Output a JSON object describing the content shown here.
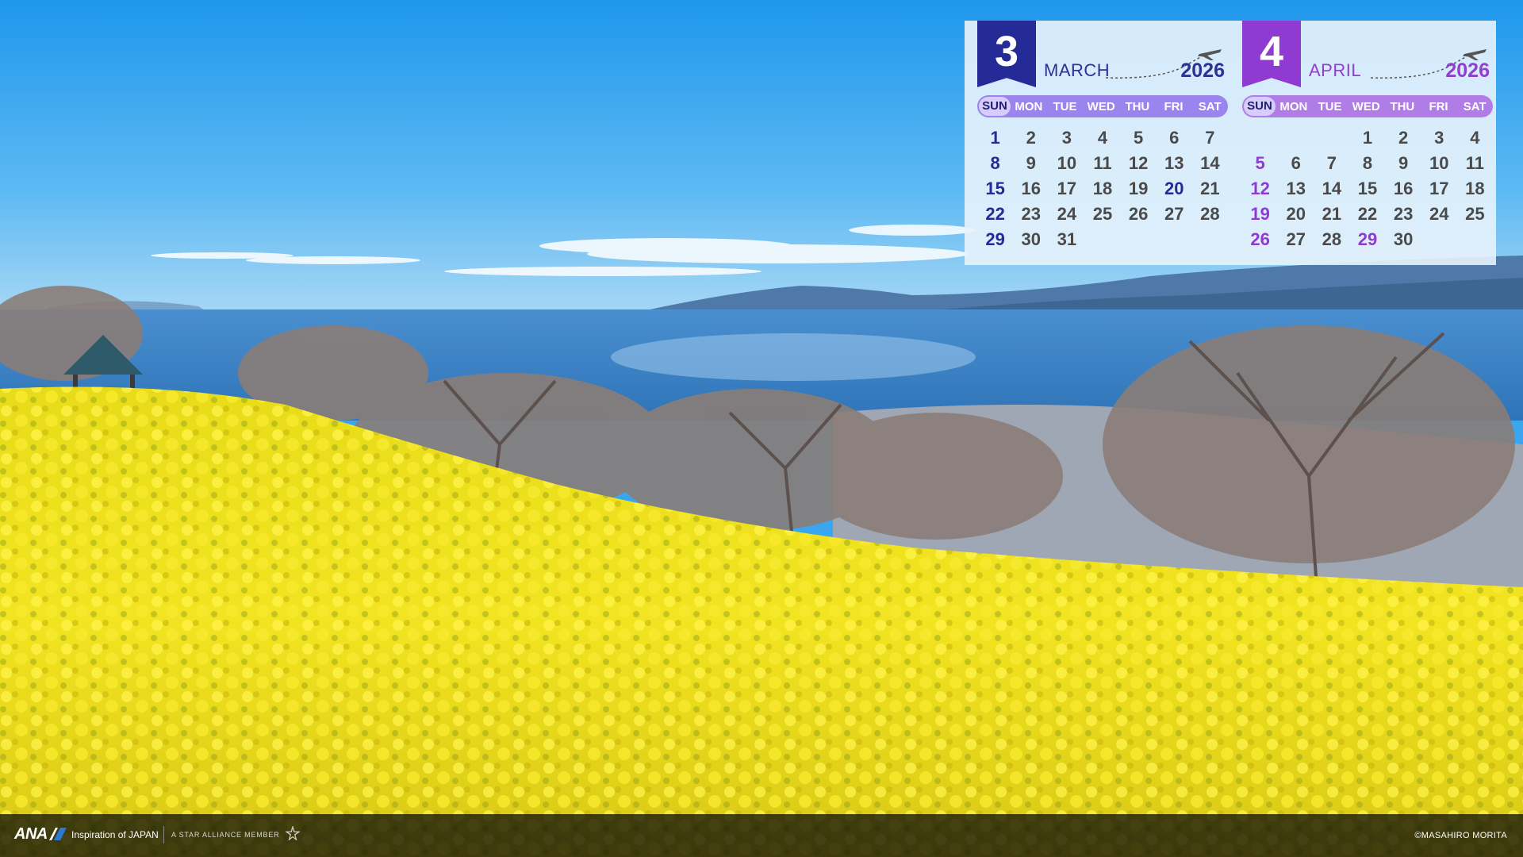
{
  "calendar": {
    "months": [
      {
        "number": "3",
        "name": "MARCH",
        "year": "2026",
        "weekdays": [
          "SUN",
          "MON",
          "TUE",
          "WED",
          "THU",
          "FRI",
          "SAT"
        ],
        "lead_blanks": 0,
        "days": [
          "1",
          "2",
          "3",
          "4",
          "5",
          "6",
          "7",
          "8",
          "9",
          "10",
          "11",
          "12",
          "13",
          "14",
          "15",
          "16",
          "17",
          "18",
          "19",
          "20",
          "21",
          "22",
          "23",
          "24",
          "25",
          "26",
          "27",
          "28",
          "29",
          "30",
          "31"
        ],
        "highlight_days": [
          "20"
        ]
      },
      {
        "number": "4",
        "name": "APRIL",
        "year": "2026",
        "weekdays": [
          "SUN",
          "MON",
          "TUE",
          "WED",
          "THU",
          "FRI",
          "SAT"
        ],
        "lead_blanks": 3,
        "days": [
          "1",
          "2",
          "3",
          "4",
          "5",
          "6",
          "7",
          "8",
          "9",
          "10",
          "11",
          "12",
          "13",
          "14",
          "15",
          "16",
          "17",
          "18",
          "19",
          "20",
          "21",
          "22",
          "23",
          "24",
          "25",
          "26",
          "27",
          "28",
          "29",
          "30"
        ],
        "highlight_days": [
          "29"
        ]
      }
    ]
  },
  "footer": {
    "logo_text": "ANA",
    "tagline": "Inspiration of JAPAN",
    "alliance": "A STAR ALLIANCE MEMBER",
    "credit": "©MASAHIRO MORITA"
  },
  "colors": {
    "march_accent": "#242a96",
    "april_accent": "#8f3ad0",
    "flowers": "#f2e21a",
    "sky": "#3aa6ef",
    "sea": "#3f86c8"
  },
  "icons": [
    "airplane-icon",
    "ana-wing-icon",
    "star-alliance-icon"
  ]
}
